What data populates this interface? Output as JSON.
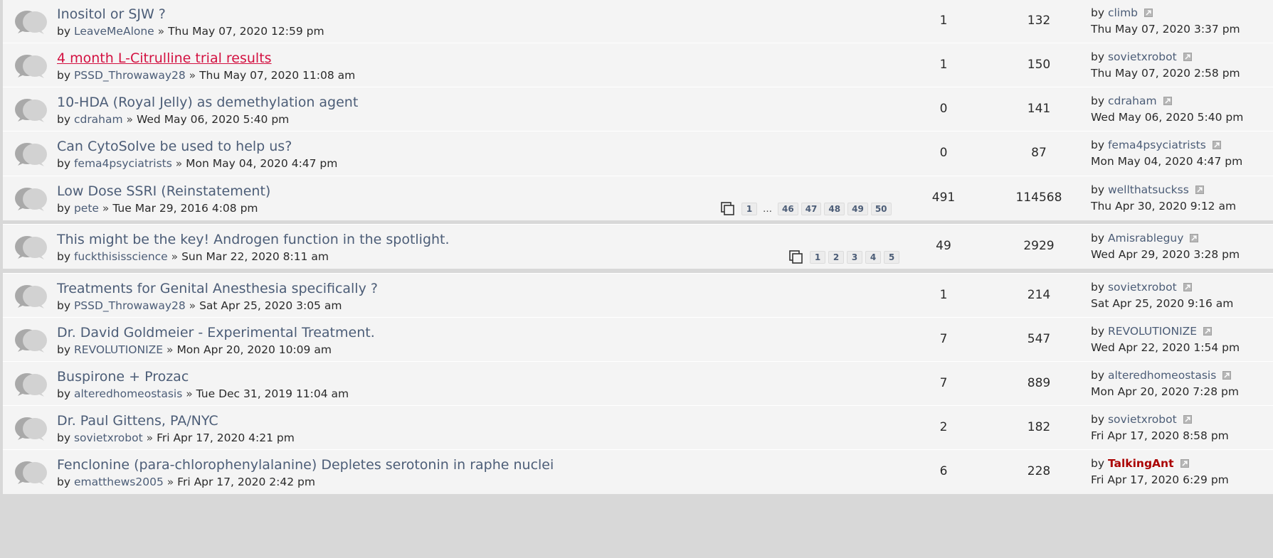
{
  "topics": [
    {
      "title": "Inositol or SJW ?",
      "author": "LeaveMeAlone",
      "posted": "Thu May 07, 2020 12:59 pm",
      "replies": "1",
      "views": "132",
      "last_by": "climb",
      "last_date": "Thu May 07, 2020 3:37 pm"
    },
    {
      "title": "4 month L-Citrulline trial results",
      "author": "PSSD_Throwaway28",
      "posted": "Thu May 07, 2020 11:08 am",
      "replies": "1",
      "views": "150",
      "last_by": "sovietxrobot",
      "last_date": "Thu May 07, 2020 2:58 pm"
    },
    {
      "title": "10-HDA (Royal Jelly) as demethylation agent",
      "author": "cdraham",
      "posted": "Wed May 06, 2020 5:40 pm",
      "replies": "0",
      "views": "141",
      "last_by": "cdraham",
      "last_date": "Wed May 06, 2020 5:40 pm"
    },
    {
      "title": "Can CytoSolve be used to help us?",
      "author": "fema4psyciatrists",
      "posted": "Mon May 04, 2020 4:47 pm",
      "replies": "0",
      "views": "87",
      "last_by": "fema4psyciatrists",
      "last_date": "Mon May 04, 2020 4:47 pm"
    },
    {
      "title": "Low Dose SSRI (Reinstatement)",
      "author": "pete",
      "posted": "Tue Mar 29, 2016 4:08 pm",
      "replies": "491",
      "views": "114568",
      "last_by": "wellthatsuckss",
      "last_date": "Thu Apr 30, 2020 9:12 am",
      "pages": [
        "1",
        "…",
        "46",
        "47",
        "48",
        "49",
        "50"
      ]
    },
    {
      "title": "This might be the key! Androgen function in the spotlight.",
      "author": "fuckthisisscience",
      "posted": "Sun Mar 22, 2020 8:11 am",
      "replies": "49",
      "views": "2929",
      "last_by": "Amisrableguy",
      "last_date": "Wed Apr 29, 2020 3:28 pm",
      "pages": [
        "1",
        "2",
        "3",
        "4",
        "5"
      ]
    },
    {
      "title": "Treatments for Genital Anesthesia specifically ?",
      "author": "PSSD_Throwaway28",
      "posted": "Sat Apr 25, 2020 3:05 am",
      "replies": "1",
      "views": "214",
      "last_by": "sovietxrobot",
      "last_date": "Sat Apr 25, 2020 9:16 am"
    },
    {
      "title": "Dr. David Goldmeier - Experimental Treatment.",
      "author": "REVOLUTIONIZE",
      "posted": "Mon Apr 20, 2020 10:09 am",
      "replies": "7",
      "views": "547",
      "last_by": "REVOLUTIONIZE",
      "last_date": "Wed Apr 22, 2020 1:54 pm"
    },
    {
      "title": "Buspirone + Prozac",
      "author": "alteredhomeostasis",
      "posted": "Tue Dec 31, 2019 11:04 am",
      "replies": "7",
      "views": "889",
      "last_by": "alteredhomeostasis",
      "last_date": "Mon Apr 20, 2020 7:28 pm"
    },
    {
      "title": "Dr. Paul Gittens, PA/NYC",
      "author": "sovietxrobot",
      "posted": "Fri Apr 17, 2020 4:21 pm",
      "replies": "2",
      "views": "182",
      "last_by": "sovietxrobot",
      "last_date": "Fri Apr 17, 2020 8:58 pm"
    },
    {
      "title": "Fenclonine (para-chlorophenylalanine) Depletes serotonin in raphe nuclei",
      "author": "ematthews2005",
      "posted": "Fri Apr 17, 2020 2:42 pm",
      "replies": "6",
      "views": "228",
      "last_by": "TalkingAnt",
      "last_date": "Fri Apr 17, 2020 6:29 pm"
    }
  ],
  "labels": {
    "by": "by",
    "separator": "»"
  },
  "colors": {
    "link": "#4c5d77",
    "hot_title": "#d31141",
    "admin_user": "#aa0000",
    "row_bg": "#f4f4f4"
  },
  "icons": {
    "topic": "topic-bubble-icon",
    "goto_last": "goto-last-post-icon",
    "multipage": "multipage-icon"
  }
}
